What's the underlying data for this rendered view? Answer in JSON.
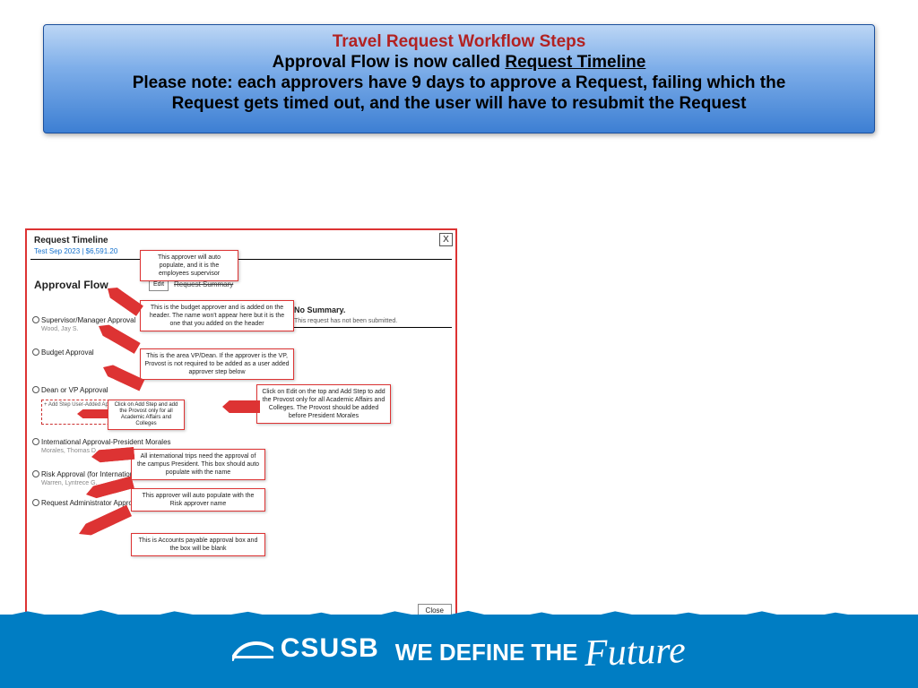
{
  "banner": {
    "line1": "Travel Request Workflow Steps",
    "line2_prefix": "Approval Flow is now called ",
    "line2_underlined": "Request Timeline",
    "line3a": "Please note: each approvers have 9 days to approve a Request, failing which the",
    "line3b": "Request gets timed out, and the user will have to resubmit the Request"
  },
  "shot": {
    "title": "Request Timeline",
    "sub": "Test Sep 2023 | $6,591.20",
    "close_x": "X",
    "flow": "Approval Flow",
    "edit": "Edit",
    "hdr2": "Request Summary",
    "nosum": "No Summary.",
    "nosum2": "This request has not been submitted.",
    "close_btn": "Close",
    "steps": [
      {
        "name": "Supervisor/Manager Approval",
        "sub": "Wood, Jay S."
      },
      {
        "name": "Budget Approval",
        "sub": ""
      },
      {
        "name": "Dean or VP Approval",
        "sub": ""
      },
      {
        "name": "International Approval-President Morales",
        "sub": "Morales, Thomas D."
      },
      {
        "name": "Risk Approval (for International Trips only)",
        "sub": "Warren, Lyntrece G."
      },
      {
        "name": "Request Administrator Approval (Accounts Payable Only)",
        "sub": ""
      }
    ],
    "addstep": "+ Add Step\nUser-Added Approver",
    "addstep_tip": "Click on Add Step and add the Provost only for all Academic Affairs and Colleges",
    "callouts": {
      "c1": "This approver will auto populate, and it is the employees supervisor",
      "c2": "This is the budget approver and is added on the header. The name won't appear here but it is the one that you added on the header",
      "c3": "This is the area VP/Dean. If the approver is the VP, Provost is not required to be added as a user added approver step below",
      "c4": "Click on Edit on the top and Add Step to add the Provost only for all Academic Affairs and Colleges. The Provost should be added before President Morales",
      "c5": "All international trips need the approval of the campus President. This box should auto populate with the name",
      "c6": "This approver will auto populate with the Risk approver name",
      "c7": "This is Accounts payable approval box and the box will be blank"
    }
  },
  "footer": {
    "brand": "CSUSB",
    "tag_pre": "WE DEFINE THE",
    "tag_script": "Future"
  }
}
